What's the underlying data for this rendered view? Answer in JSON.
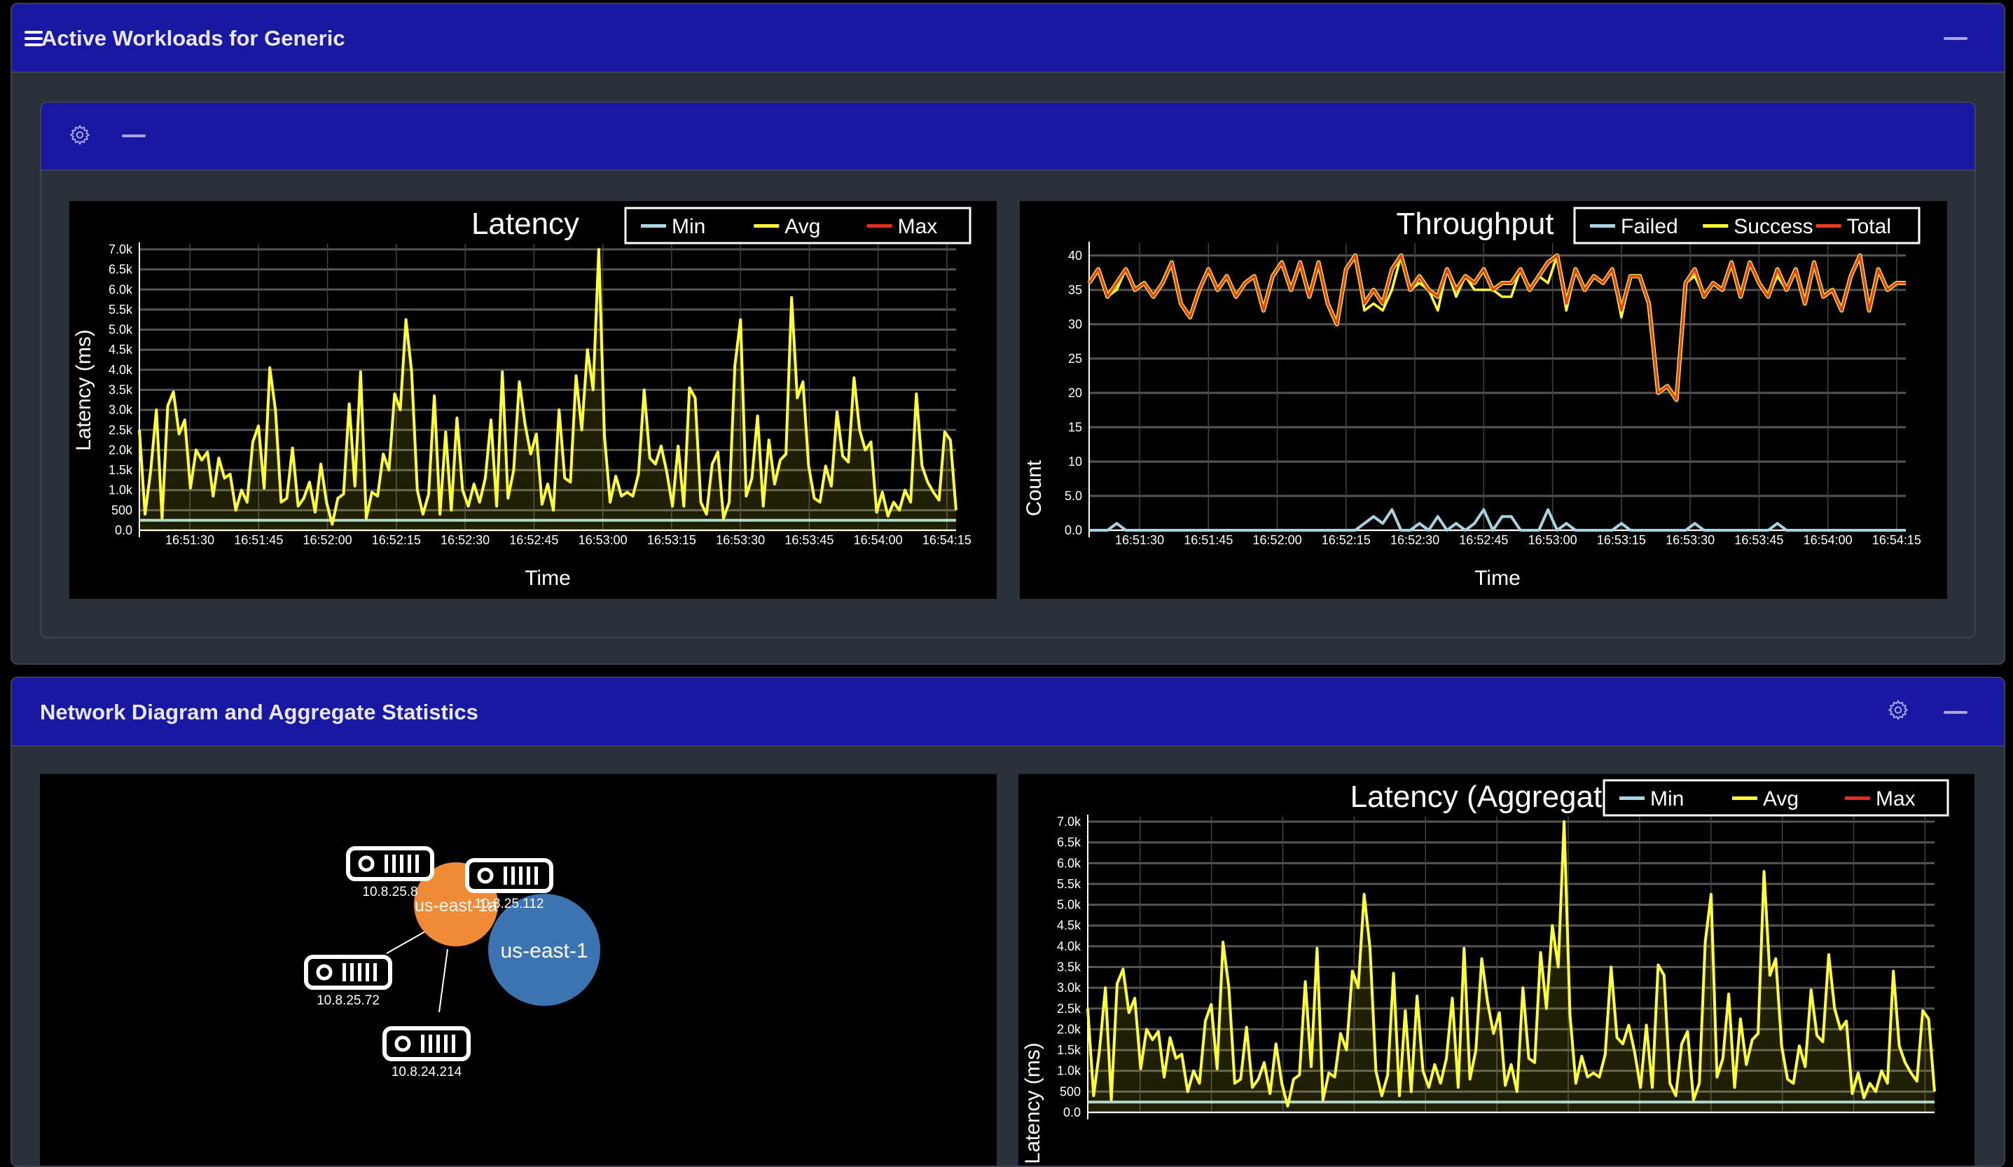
{
  "top_panel": {
    "title": "Active Workloads for Generic",
    "icons": [
      "menu-icon",
      "minimize-icon"
    ]
  },
  "inner_card": {
    "icons": [
      "gear-icon",
      "minimize-icon"
    ]
  },
  "bottom_panel": {
    "title": "Network Diagram and Aggregate Statistics",
    "icons": [
      "gear-icon",
      "minimize-icon"
    ]
  },
  "network": {
    "nodes": [
      {
        "label": "us-east-1",
        "color": "#3b74b0"
      },
      {
        "label": "us-east-1a",
        "color": "#ef8a37"
      }
    ],
    "servers": [
      "10.8.25.8",
      "10.8.25.112",
      "10.8.25.72",
      "10.8.24.214"
    ]
  },
  "chart_data": [
    {
      "type": "line",
      "title": "Latency",
      "xlabel": "Time",
      "ylabel": "Latency (ms)",
      "x_range": [
        "16:51:19",
        "16:54:17"
      ],
      "x_ticks": [
        "16:51:30",
        "16:51:45",
        "16:52:00",
        "16:52:15",
        "16:52:30",
        "16:52:45",
        "16:53:00",
        "16:53:15",
        "16:53:30",
        "16:53:45",
        "16:54:00",
        "16:54:15"
      ],
      "y_ticks": [
        "0.0",
        "500",
        "1.0k",
        "1.5k",
        "2.0k",
        "2.5k",
        "3.0k",
        "3.5k",
        "4.0k",
        "4.5k",
        "5.0k",
        "5.5k",
        "6.0k",
        "6.5k",
        "7.0k"
      ],
      "ylim": [
        0,
        7000
      ],
      "grid": true,
      "legend": "top-right",
      "series": [
        {
          "name": "Min",
          "color": "#a8d4e0",
          "visible": true,
          "values": [
            250,
            250,
            250,
            250,
            250,
            250,
            250,
            250,
            250,
            250,
            250,
            250,
            250,
            250,
            250,
            250,
            250,
            250,
            250,
            250,
            250,
            250,
            250,
            250,
            250,
            250,
            250,
            250,
            250,
            250
          ]
        },
        {
          "name": "Avg",
          "color": "#ffff33",
          "visible": true,
          "filled": true,
          "values": [
            2500,
            400,
            1500,
            3000,
            300,
            3100,
            3450,
            2400,
            2750,
            1050,
            2000,
            1750,
            1950,
            850,
            1800,
            1300,
            1400,
            500,
            1000,
            700,
            2200,
            2600,
            1050,
            4050,
            3000,
            700,
            800,
            2050,
            600,
            800,
            1200,
            450,
            1650,
            700,
            150,
            800,
            900,
            3150,
            1100,
            3950,
            300,
            950,
            850,
            1900,
            1500,
            3400,
            3000,
            5250,
            3950,
            1000,
            400,
            900,
            3350,
            400,
            2450,
            500,
            2800,
            1000,
            600,
            1150,
            700,
            1300,
            2750,
            600,
            3950,
            800,
            1500,
            3700,
            2650,
            1900,
            2400,
            650,
            1150,
            500,
            3000,
            1300,
            1200,
            3850,
            2500,
            4500,
            3500,
            7000,
            2350,
            700,
            1350,
            850,
            950,
            850,
            1400,
            3500,
            1800,
            1650,
            2100,
            1450,
            600,
            2100,
            600,
            3550,
            3300,
            700,
            400,
            1650,
            1950,
            300,
            700,
            4100,
            5250,
            850,
            1300,
            2850,
            600,
            2250,
            1150,
            1750,
            1900,
            5800,
            3300,
            3700,
            1600,
            800,
            700,
            1600,
            1100,
            2950,
            1850,
            1700,
            3800,
            2500,
            2000,
            2200,
            450,
            950,
            350,
            700,
            500,
            1000,
            700,
            3400,
            1600,
            1200,
            950,
            750,
            2450,
            2250,
            500
          ]
        },
        {
          "name": "Max",
          "color": "#e0301e",
          "visible": false,
          "values": []
        }
      ]
    },
    {
      "type": "line",
      "title": "Throughput",
      "xlabel": "Time",
      "ylabel": "Count",
      "x_range": [
        "16:51:19",
        "16:54:17"
      ],
      "x_ticks": [
        "16:51:30",
        "16:51:45",
        "16:52:00",
        "16:52:15",
        "16:52:30",
        "16:52:45",
        "16:53:00",
        "16:53:15",
        "16:53:30",
        "16:53:45",
        "16:54:00",
        "16:54:15"
      ],
      "y_ticks": [
        "0.0",
        "5.0",
        "10",
        "15",
        "20",
        "25",
        "30",
        "35",
        "40"
      ],
      "ylim": [
        0,
        41
      ],
      "grid": true,
      "legend": "top-right",
      "series": [
        {
          "name": "Failed",
          "color": "#a8d4e0",
          "visible": true,
          "values": [
            0,
            0,
            0,
            1,
            0,
            0,
            0,
            0,
            0,
            0,
            0,
            0,
            0,
            0,
            0,
            0,
            0,
            0,
            0,
            0,
            0,
            0,
            0,
            0,
            0,
            0,
            0,
            0,
            0,
            0,
            1,
            2,
            1,
            3,
            0,
            0,
            1,
            0,
            2,
            0,
            1,
            0,
            1,
            3,
            0,
            2,
            2,
            0,
            0,
            0,
            3,
            0,
            1,
            0,
            0,
            0,
            0,
            0,
            1,
            0,
            0,
            0,
            0,
            0,
            0,
            0,
            1,
            0,
            0,
            0,
            0,
            0,
            0,
            0,
            0,
            1,
            0,
            0,
            0,
            0,
            0,
            0,
            0,
            0,
            0,
            0,
            0,
            0,
            0,
            0
          ]
        },
        {
          "name": "Success",
          "color": "#ffff33",
          "visible": true,
          "values": [
            36,
            38,
            34,
            35,
            38,
            35,
            36,
            34,
            36,
            39,
            33,
            31,
            35,
            38,
            35,
            37,
            34,
            36,
            37,
            32,
            37,
            39,
            35,
            39,
            34,
            39,
            33,
            30,
            38,
            40,
            32,
            33,
            32,
            35,
            40,
            35,
            36,
            35,
            32,
            38,
            34,
            37,
            35,
            35,
            35,
            34,
            34,
            38,
            35,
            37,
            36,
            40,
            32,
            38,
            35,
            37,
            36,
            38,
            31,
            37,
            37,
            33,
            20,
            21,
            19,
            36,
            37,
            34,
            36,
            35,
            39,
            34,
            39,
            36,
            34,
            37,
            35,
            38,
            33,
            39,
            34,
            35,
            32,
            37,
            40,
            32,
            38,
            35,
            36,
            36
          ]
        },
        {
          "name": "Total",
          "color": "#e8401e",
          "visible": true,
          "values": [
            36,
            38,
            34,
            36,
            38,
            35,
            36,
            34,
            36,
            39,
            33,
            31,
            35,
            38,
            35,
            37,
            34,
            36,
            37,
            32,
            37,
            39,
            35,
            39,
            34,
            39,
            33,
            30,
            38,
            40,
            33,
            35,
            33,
            38,
            40,
            35,
            37,
            35,
            34,
            38,
            35,
            37,
            36,
            38,
            35,
            36,
            36,
            38,
            35,
            37,
            39,
            40,
            33,
            38,
            35,
            37,
            36,
            38,
            32,
            37,
            37,
            33,
            20,
            21,
            19,
            36,
            38,
            34,
            36,
            35,
            39,
            34,
            39,
            36,
            34,
            38,
            35,
            38,
            33,
            39,
            34,
            35,
            32,
            37,
            40,
            32,
            38,
            35,
            36,
            36
          ]
        }
      ]
    },
    {
      "type": "line",
      "title": "Latency (Aggregate)",
      "ylabel": "Latency (ms)",
      "x_range": [
        "16:51:19",
        "16:54:17"
      ],
      "y_ticks": [
        "0.0",
        "500",
        "1.0k",
        "1.5k",
        "2.0k",
        "2.5k",
        "3.0k",
        "3.5k",
        "4.0k",
        "4.5k",
        "5.0k",
        "5.5k",
        "6.0k",
        "6.5k",
        "7.0k"
      ],
      "ylim": [
        0,
        7000
      ],
      "grid": true,
      "legend": "top-right",
      "series": [
        {
          "name": "Min",
          "color": "#a8d4e0",
          "visible": true,
          "values": [
            250,
            250,
            250,
            250,
            250,
            250,
            250,
            250,
            250,
            250
          ]
        },
        {
          "name": "Avg",
          "color": "#ffff33",
          "visible": true,
          "filled": true,
          "values": [
            2500,
            400,
            1500,
            3000,
            300,
            3100,
            3450,
            2400,
            2750,
            1050,
            2000,
            1750,
            1950,
            850,
            1800,
            1300,
            1400,
            500,
            1000,
            700,
            2200,
            2600,
            1050,
            4100,
            3000,
            700,
            800,
            2050,
            600,
            800,
            1200,
            450,
            1650,
            700,
            150,
            800,
            900,
            3150,
            1100,
            3950,
            300,
            950,
            850,
            1900,
            1500,
            3400,
            3000,
            5250,
            3950,
            1000,
            400,
            900,
            3350,
            400,
            2450,
            500,
            2800,
            1000,
            600,
            1150,
            700,
            1300,
            2750,
            600,
            3950,
            800,
            1500,
            3700,
            2650,
            1900,
            2400,
            650,
            1150,
            500,
            3000,
            1300,
            1200,
            3850,
            2500,
            4500,
            3500,
            7000,
            2350,
            700,
            1350,
            850,
            950,
            850,
            1400,
            3500,
            1800,
            1650,
            2100,
            1450,
            600,
            2100,
            600,
            3550,
            3300,
            700,
            400,
            1650,
            1950,
            300,
            700,
            4100,
            5250,
            850,
            1300,
            2850,
            600,
            2250,
            1150,
            1750,
            1900,
            5800,
            3300,
            3700,
            1600,
            800,
            700,
            1600,
            1100,
            2950,
            1850,
            1700,
            3800,
            2500,
            2000,
            2200,
            450,
            950,
            350,
            700,
            500,
            1000,
            700,
            3400,
            1600,
            1200,
            950,
            750,
            2450,
            2250,
            500
          ]
        },
        {
          "name": "Max",
          "color": "#e0301e",
          "visible": false,
          "values": []
        }
      ]
    }
  ]
}
